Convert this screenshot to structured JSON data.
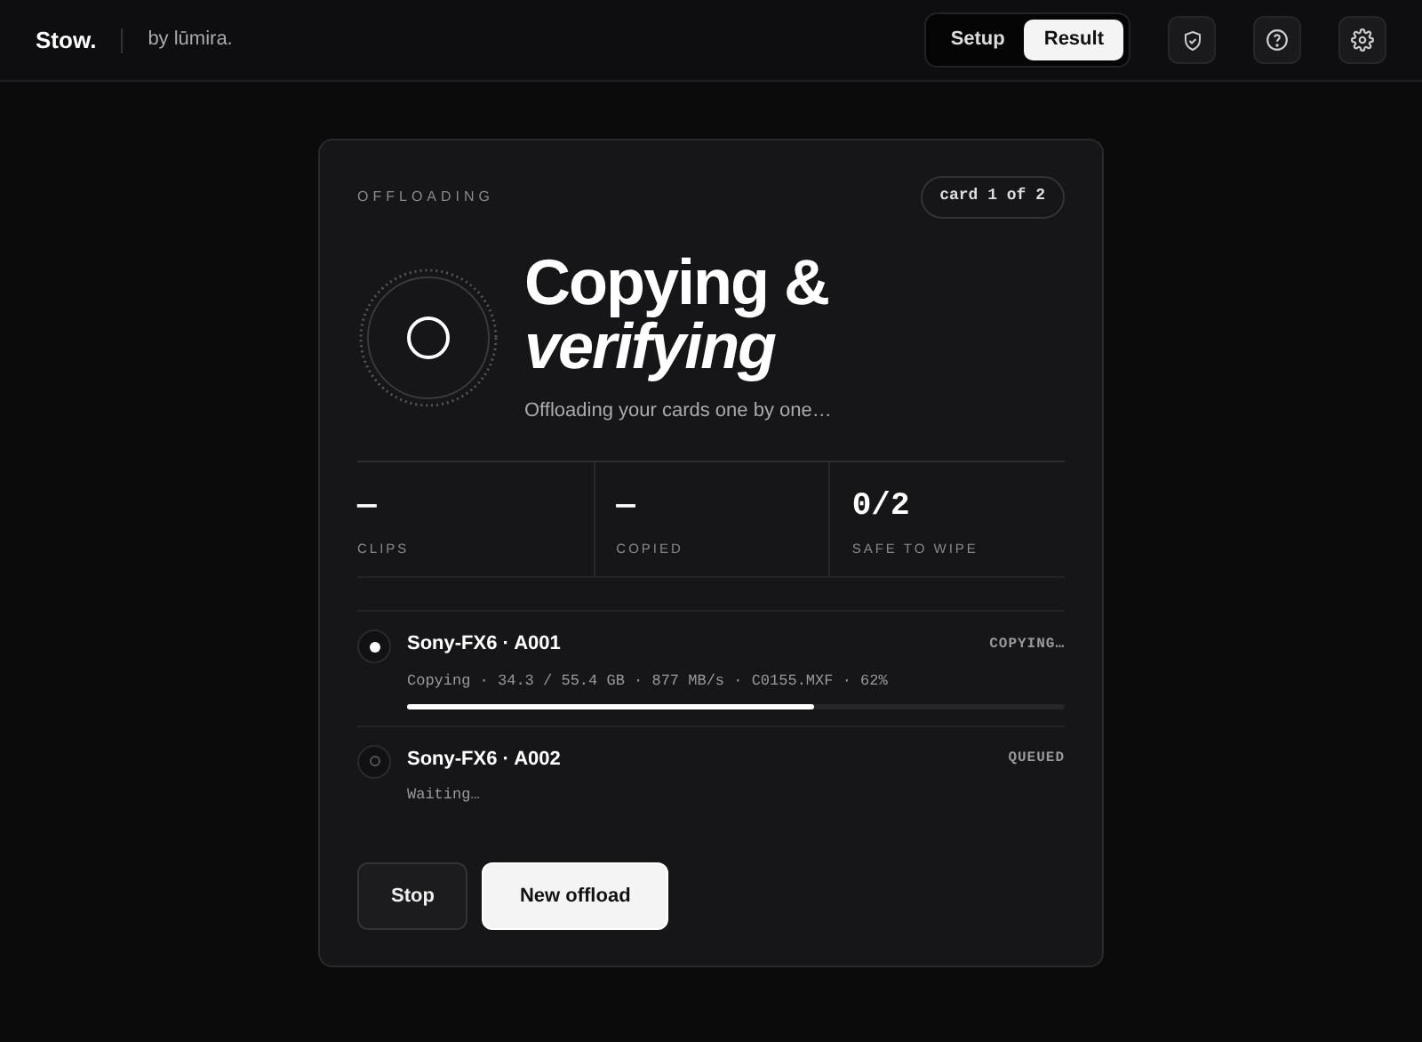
{
  "brand": {
    "name": "Stow.",
    "by": "by lūmira."
  },
  "mode_tabs": [
    {
      "label": "Setup",
      "selected": false
    },
    {
      "label": "Result",
      "selected": true
    }
  ],
  "panel": {
    "eyebrow": "OFFLOADING",
    "counter": "card 1 of 2",
    "title": "Copying &",
    "title_emphasis": "verifying",
    "subtitle": "Offloading your cards one by one…",
    "stats": [
      {
        "value": "—",
        "label": "CLIPS"
      },
      {
        "value": "—",
        "label": "COPIED"
      },
      {
        "value": "0/2",
        "label": "SAFE TO WIPE"
      }
    ],
    "cards": [
      {
        "name": "Sony-FX6 · A001",
        "status": "COPYING…",
        "active": true,
        "detail": "Copying · 34.3 / 55.4 GB · 877 MB/s · C0155.MXF · 62%",
        "level": 0.62
      },
      {
        "name": "Sony-FX6 · A002",
        "status": "QUEUED",
        "active": false,
        "detail": "Waiting…"
      }
    ],
    "buttons": [
      {
        "label": "Stop",
        "kind": "secondary"
      },
      {
        "label": "New offload",
        "kind": "primary"
      }
    ]
  }
}
